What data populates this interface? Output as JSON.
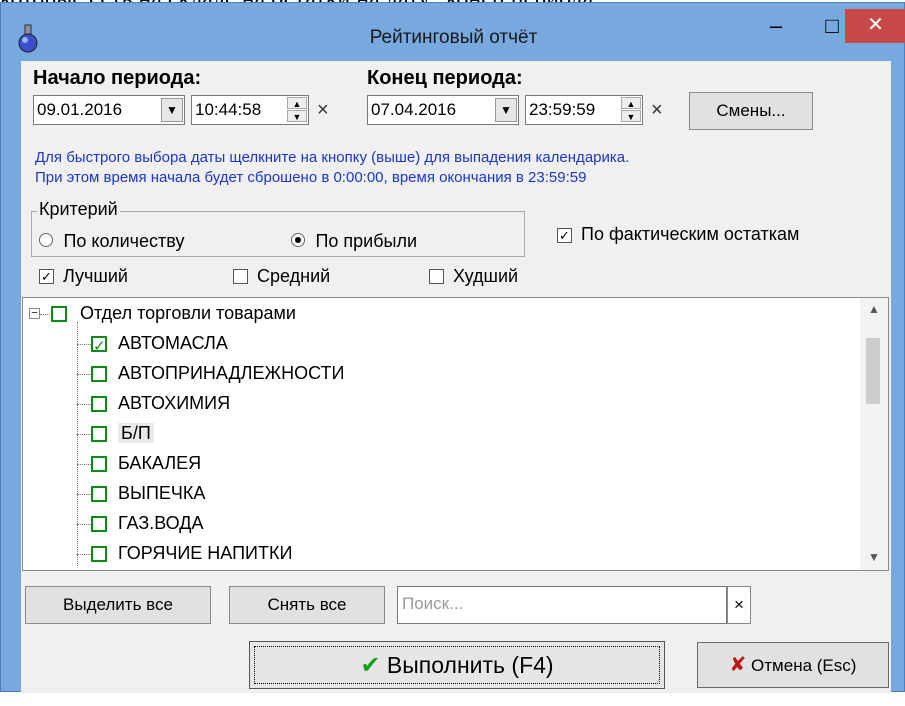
{
  "document_caption": "которые есть на складе на остатки на дату \"конец периода\".",
  "window": {
    "title": "Рейтинговый отчёт",
    "minimize_label": "–",
    "maximize_label": "□",
    "close_label": "✕"
  },
  "period": {
    "start_label": "Начало периода:",
    "start_date": "09.01.2016",
    "start_time": "10:44:58",
    "end_label": "Конец периода:",
    "end_date": "07.04.2016",
    "end_time": "23:59:59",
    "clear_mark": "×",
    "shifts_button": "Смены..."
  },
  "hint": {
    "line1": "Для быстрого выбора даты щелкните на кнопку (выше) для выпадения календарика.",
    "line2": "При этом время начала будет сброшено в 0:00:00, время окончания в 23:59:59"
  },
  "criteria": {
    "group_title": "Критерий",
    "by_quantity": "По количеству",
    "by_profit": "По прибыли",
    "selected": "by_profit",
    "actual_stock_label": "По фактическим остаткам",
    "actual_stock_checked": true
  },
  "ratings": [
    {
      "label": "Лучший",
      "checked": true
    },
    {
      "label": "Средний",
      "checked": false
    },
    {
      "label": "Худший",
      "checked": false
    }
  ],
  "tree": {
    "root": "Отдел торговли товарами",
    "items": [
      {
        "label": "АВТОМАСЛА",
        "checked": true
      },
      {
        "label": "АВТОПРИНАДЛЕЖНОСТИ",
        "checked": false
      },
      {
        "label": "АВТОХИМИЯ",
        "checked": false
      },
      {
        "label": "Б/П",
        "checked": false
      },
      {
        "label": "БАКАЛЕЯ",
        "checked": false
      },
      {
        "label": "ВЫПЕЧКА",
        "checked": false
      },
      {
        "label": "ГАЗ.ВОДА",
        "checked": false
      },
      {
        "label": "ГОРЯЧИЕ НАПИТКИ",
        "checked": false
      }
    ]
  },
  "bottom": {
    "select_all": "Выделить все",
    "deselect_all": "Снять все",
    "search_placeholder": "Поиск...",
    "search_clear": "×",
    "execute": "Выполнить (F4)",
    "cancel": "Отмена (Esc)"
  },
  "colors": {
    "titlebar": "#77a8de",
    "close_button": "#c7494a",
    "hint_text": "#1b37c9",
    "tree_checkbox": "#0b8a16"
  }
}
